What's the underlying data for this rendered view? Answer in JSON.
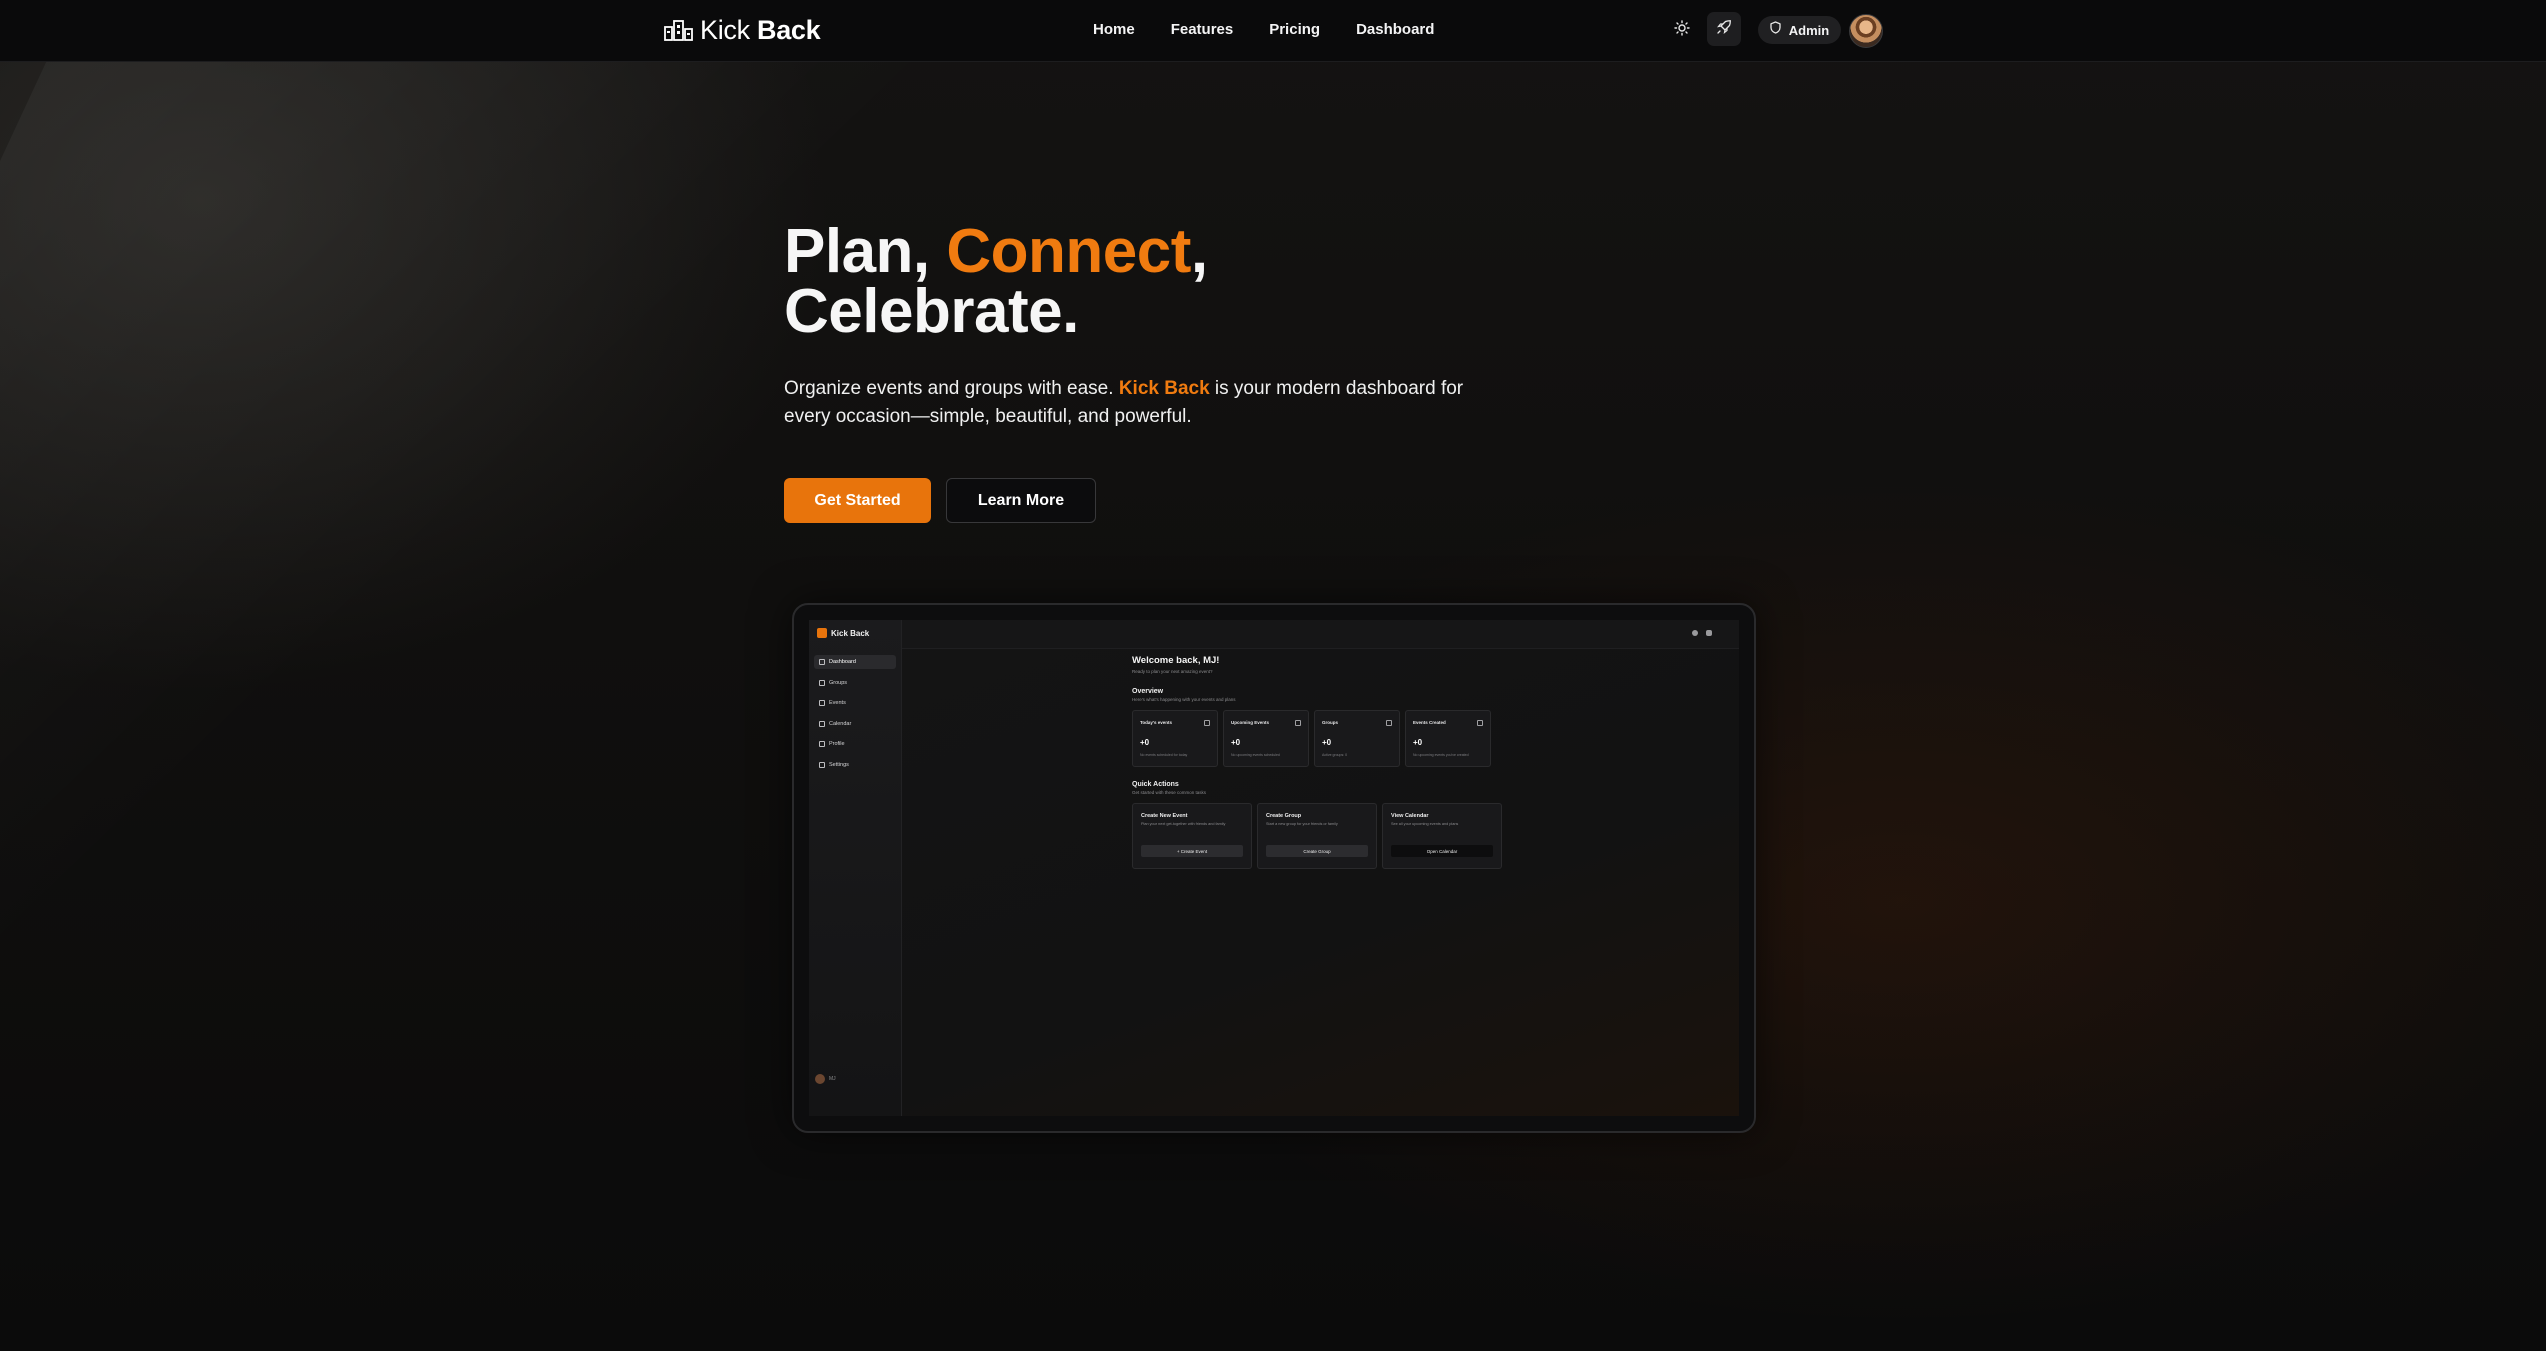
{
  "header": {
    "brand": {
      "light": "Kick",
      "bold": "Back"
    },
    "nav": [
      {
        "label": "Home"
      },
      {
        "label": "Features"
      },
      {
        "label": "Pricing"
      },
      {
        "label": "Dashboard"
      }
    ],
    "theme_icon": "sun-icon",
    "rocket_icon": "rocket-icon",
    "admin_label": "Admin",
    "admin_icon": "shield-icon"
  },
  "hero": {
    "title_line1_a": "Plan, ",
    "title_line1_accent": "Connect",
    "title_line1_b": ",",
    "title_line2": "Celebrate.",
    "subtitle_a": "Organize events and groups with ease. ",
    "subtitle_accent": "Kick Back",
    "subtitle_b": " is your modern dashboard for every occasion—simple, beautiful, and powerful.",
    "primary_cta": "Get Started",
    "secondary_cta": "Learn More",
    "accent_color": "#f07b10"
  },
  "preview": {
    "brand": "Kick Back",
    "sidebar": [
      {
        "label": "Dashboard",
        "active": true
      },
      {
        "label": "Groups"
      },
      {
        "label": "Events"
      },
      {
        "label": "Calendar"
      },
      {
        "label": "Profile"
      },
      {
        "label": "Settings"
      }
    ],
    "user_label": "MJ",
    "welcome": "Welcome back, MJ!",
    "welcome_sub": "Ready to plan your next amazing event?",
    "overview_title": "Overview",
    "overview_sub": "Here's what's happening with your events and plans",
    "stats": [
      {
        "label": "Today's events",
        "value": "+0",
        "note": "No events scheduled for today"
      },
      {
        "label": "Upcoming Events",
        "value": "+0",
        "note": "No upcoming events scheduled"
      },
      {
        "label": "Groups",
        "value": "+0",
        "note": "Active groups: 0"
      },
      {
        "label": "Events Created",
        "value": "+0",
        "note": "No upcoming events you've created"
      }
    ],
    "quick_title": "Quick Actions",
    "quick_sub": "Get started with these common tasks",
    "actions": [
      {
        "title": "Create New Event",
        "desc": "Plan your next get-together with friends and family",
        "button": "+  Create Event"
      },
      {
        "title": "Create Group",
        "desc": "Start a new group for your friends or family",
        "button": "Create Group"
      },
      {
        "title": "View Calendar",
        "desc": "See all your upcoming events and plans",
        "button": "Open Calendar"
      }
    ]
  }
}
